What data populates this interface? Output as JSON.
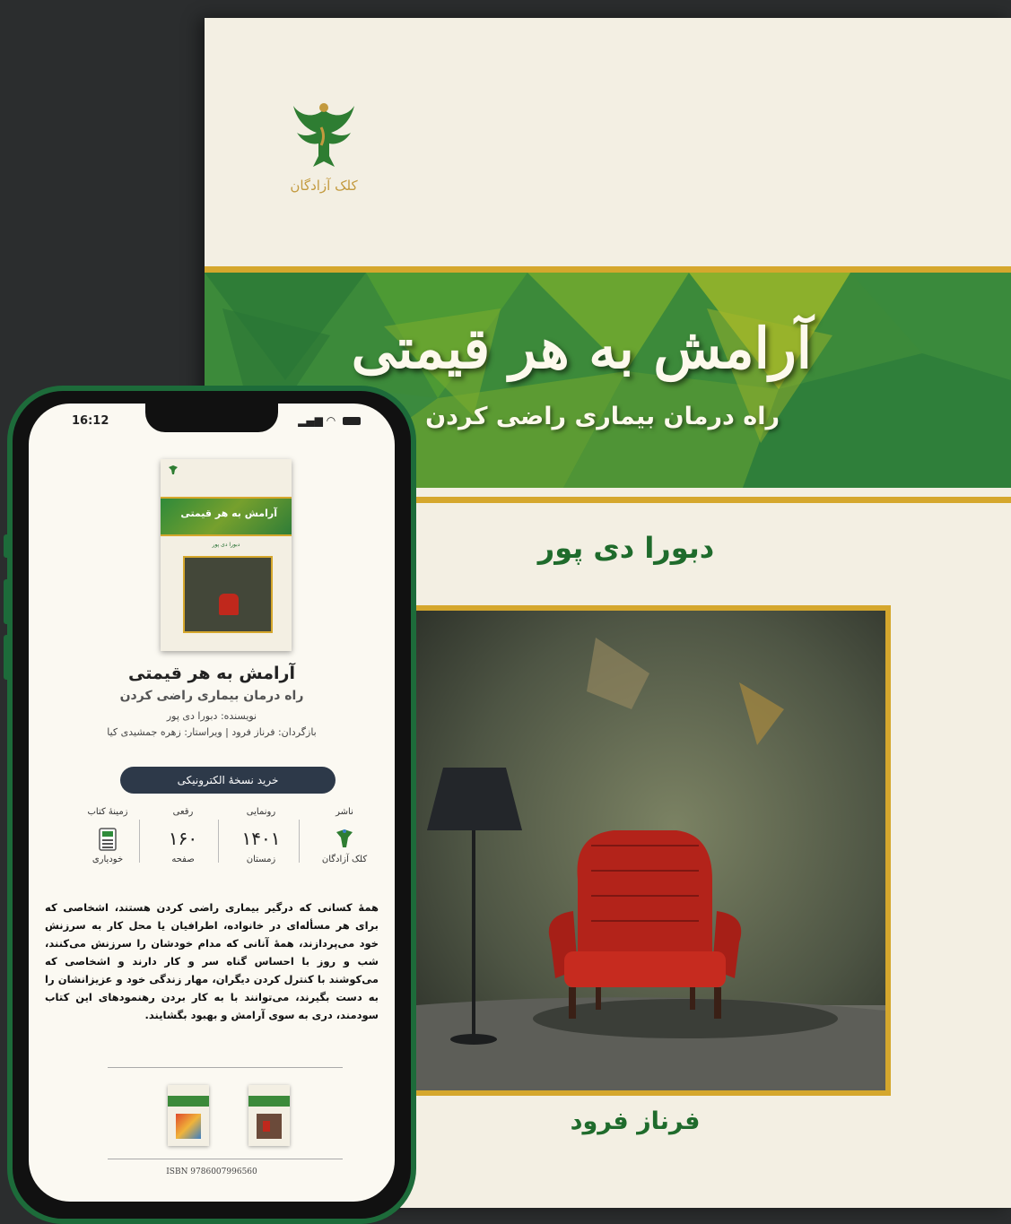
{
  "cover": {
    "publisher_name": "کلک آزادگان",
    "title": "آرامش به هر قیمتی",
    "subtitle": "راه درمان بیماری راضی کردن",
    "author": "دبورا دی پور",
    "translator": "فرناز فرود"
  },
  "phone": {
    "status_time": "16:12",
    "title": "آرامش به هر قیمتی",
    "subtitle": "راه درمان بیماری راضی کردن",
    "author_line": "نویسنده: دبورا دی پور",
    "credits_line": "بازگردان: فرناز فرود | ویراستار: زهره جمشیدی کیا",
    "buy_button": "خرید نسخهٔ الکترونیکی",
    "meta": [
      {
        "label": "ناشر",
        "value": "",
        "foot": "کلک آزادگان",
        "icon": "publisher-logo-icon"
      },
      {
        "label": "رونمایی",
        "value": "۱۴۰۱",
        "foot": "زمستان"
      },
      {
        "label": "رقعی",
        "value": "۱۶۰",
        "foot": "صفحه"
      },
      {
        "label": "زمینهٔ کتاب",
        "value": "",
        "foot": "خودیاری",
        "icon": "calculator-icon"
      }
    ],
    "description": "همهٔ کسانی که درگیر بیماری راضی کردن هستند، اشخاصی که برای هر مسأله‌ای در خانواده، اطرافیان یا محل کار به سرزنش خود می‌پردازند، همهٔ آنانی که مدام خودشان را سرزنش می‌کنند، شب و روز با احساس گناه سر و کار دارند و اشخاصی که می‌کوشند با کنترل کردن دیگران، مهار زندگی خود و عزیزانشان را به دست بگیرند، می‌توانند با به کار بردن رهنمودهای این کتاب سودمند، دری به سوی آرامش و بهبود بگشایند.",
    "isbn": "ISBN 9786007996560"
  },
  "colors": {
    "band_green": "#3c8a3a",
    "gold": "#d5a72d",
    "author_green": "#1f6b2c",
    "phone_frame": "#1d6b3a",
    "button": "#2d3949"
  }
}
